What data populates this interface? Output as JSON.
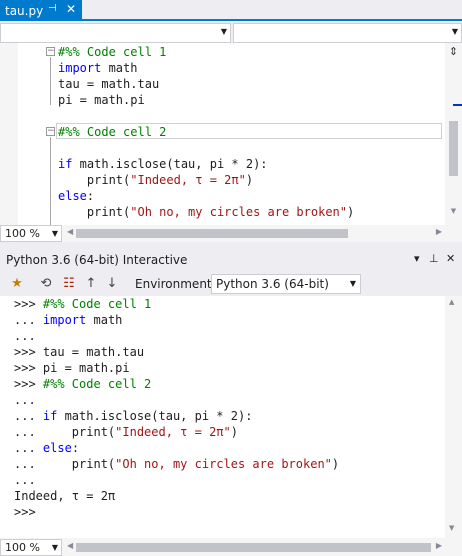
{
  "editor_tab": {
    "filename": "tau.py",
    "pin_glyph": "⊣",
    "close_glyph": "✕"
  },
  "editor": {
    "zoom": "100 %",
    "lines": [
      {
        "tokens": [
          {
            "t": "#%% Code cell 1",
            "c": "cm"
          }
        ]
      },
      {
        "tokens": [
          {
            "t": "import",
            "c": "kw"
          },
          {
            "t": " math",
            "c": "id"
          }
        ]
      },
      {
        "tokens": [
          {
            "t": "tau = ",
            "c": "id"
          },
          {
            "t": "math",
            "c": "id"
          },
          {
            "t": ".tau",
            "c": "id"
          }
        ]
      },
      {
        "tokens": [
          {
            "t": "pi = ",
            "c": "id"
          },
          {
            "t": "math",
            "c": "id"
          },
          {
            "t": ".pi",
            "c": "id"
          }
        ]
      },
      {
        "tokens": []
      },
      {
        "tokens": [
          {
            "t": "#%% Code cell 2",
            "c": "cm"
          }
        ]
      },
      {
        "tokens": []
      },
      {
        "tokens": [
          {
            "t": "if",
            "c": "kw"
          },
          {
            "t": " math.isclose(tau, pi * 2):",
            "c": "id"
          }
        ]
      },
      {
        "tokens": [
          {
            "t": "    print(",
            "c": "id"
          },
          {
            "t": "\"Indeed, τ = 2π\"",
            "c": "st"
          },
          {
            "t": ")",
            "c": "id"
          }
        ]
      },
      {
        "tokens": [
          {
            "t": "else",
            "c": "kw"
          },
          {
            "t": ":",
            "c": "id"
          }
        ]
      },
      {
        "tokens": [
          {
            "t": "    print(",
            "c": "id"
          },
          {
            "t": "\"Oh no, my circles are broken\"",
            "c": "st"
          },
          {
            "t": ")",
            "c": "id"
          }
        ]
      }
    ]
  },
  "interactive": {
    "title": "Python 3.6 (64-bit) Interactive",
    "environment_label": "Environment:",
    "environment_value": "Python 3.6 (64-bit)",
    "zoom": "100 %",
    "lines": [
      {
        "tokens": [
          {
            "t": ">>> ",
            "c": "id"
          },
          {
            "t": "#%% Code cell 1",
            "c": "cm"
          }
        ]
      },
      {
        "tokens": [
          {
            "t": "... ",
            "c": "id"
          },
          {
            "t": "import",
            "c": "kw"
          },
          {
            "t": " math",
            "c": "id"
          }
        ]
      },
      {
        "tokens": [
          {
            "t": "...",
            "c": "id"
          }
        ]
      },
      {
        "tokens": [
          {
            "t": ">>> tau = math.tau",
            "c": "id"
          }
        ]
      },
      {
        "tokens": [
          {
            "t": ">>> pi = math.pi",
            "c": "id"
          }
        ]
      },
      {
        "tokens": [
          {
            "t": ">>> ",
            "c": "id"
          },
          {
            "t": "#%% Code cell 2",
            "c": "cm"
          }
        ]
      },
      {
        "tokens": [
          {
            "t": "...",
            "c": "id"
          }
        ]
      },
      {
        "tokens": [
          {
            "t": "... ",
            "c": "id"
          },
          {
            "t": "if",
            "c": "kw"
          },
          {
            "t": " math.isclose(tau, pi * 2):",
            "c": "id"
          }
        ]
      },
      {
        "tokens": [
          {
            "t": "...     print(",
            "c": "id"
          },
          {
            "t": "\"Indeed, τ = 2π\"",
            "c": "st"
          },
          {
            "t": ")",
            "c": "id"
          }
        ]
      },
      {
        "tokens": [
          {
            "t": "... ",
            "c": "id"
          },
          {
            "t": "else",
            "c": "kw"
          },
          {
            "t": ":",
            "c": "id"
          }
        ]
      },
      {
        "tokens": [
          {
            "t": "...     print(",
            "c": "id"
          },
          {
            "t": "\"Oh no, my circles are broken\"",
            "c": "st"
          },
          {
            "t": ")",
            "c": "id"
          }
        ]
      },
      {
        "tokens": [
          {
            "t": "...",
            "c": "id"
          }
        ]
      },
      {
        "tokens": [
          {
            "t": "Indeed, τ = 2π",
            "c": "id"
          }
        ]
      },
      {
        "tokens": [
          {
            "t": ">>>",
            "c": "id"
          }
        ]
      }
    ]
  },
  "icons": {
    "pin": "⊣",
    "close": "✕",
    "dropdown": "▼",
    "split": "⇕",
    "reset": "⟲",
    "clear": "☷",
    "history_up": "↑",
    "history_down": "↓",
    "new_repl": "★",
    "window_menu": "▾",
    "autohide_pin": "⊥"
  },
  "colors": {
    "accent": "#007acc",
    "keyword": "#0000ff",
    "comment": "#008000",
    "string": "#a31515"
  }
}
